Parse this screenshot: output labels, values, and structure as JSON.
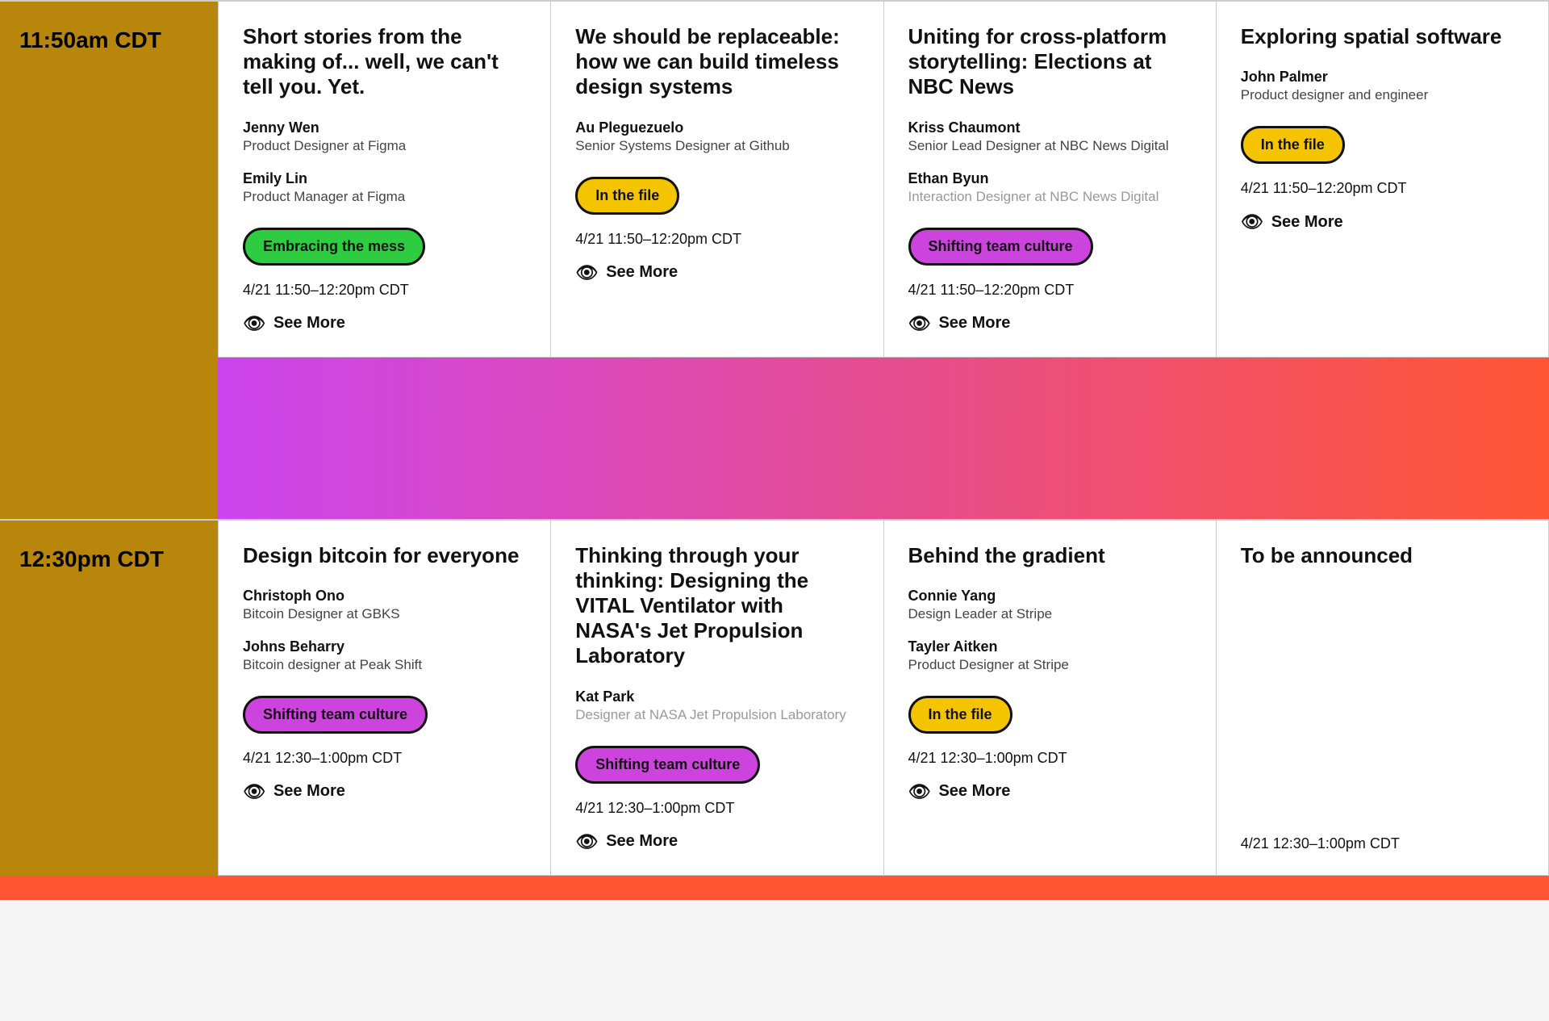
{
  "schedule": {
    "rows": [
      {
        "time": "11:50am CDT",
        "sessions": [
          {
            "title": "Short stories from the making of... well, we can't tell you. Yet.",
            "speakers": [
              {
                "name": "Jenny Wen",
                "role": "Product Designer at Figma",
                "faded": false
              },
              {
                "name": "Emily Lin",
                "role": "Product Manager at Figma",
                "faded": false
              }
            ],
            "tag": "Embracing the mess",
            "tag_color": "green",
            "time_slot": "4/21 11:50–12:20pm CDT",
            "see_more": "See More"
          },
          {
            "title": "We should be replaceable: how we can build timeless design systems",
            "speakers": [
              {
                "name": "Au Pleguezuelo",
                "role": "Senior Systems Designer at Github",
                "faded": false
              }
            ],
            "tag": "In the file",
            "tag_color": "yellow",
            "time_slot": "4/21 11:50–12:20pm CDT",
            "see_more": "See More"
          },
          {
            "title": "Uniting for cross-platform storytelling: Elections at NBC News",
            "speakers": [
              {
                "name": "Kriss Chaumont",
                "role": "Senior Lead Designer at NBC News Digital",
                "faded": false
              },
              {
                "name": "Ethan Byun",
                "role": "Interaction Designer at NBC News Digital",
                "faded": true
              }
            ],
            "tag": "Shifting team culture",
            "tag_color": "purple",
            "time_slot": "4/21 11:50–12:20pm CDT",
            "see_more": "See More"
          },
          {
            "title": "Exploring spatial software",
            "speakers": [
              {
                "name": "John Palmer",
                "role": "Product designer and engineer",
                "faded": false
              }
            ],
            "tag": "In the file",
            "tag_color": "yellow",
            "time_slot": "4/21 11:50–12:20pm CDT",
            "see_more": "See More"
          }
        ]
      },
      {
        "time": "12:30pm CDT",
        "sessions": [
          {
            "title": "Design bitcoin for everyone",
            "speakers": [
              {
                "name": "Christoph Ono",
                "role": "Bitcoin Designer at GBKS",
                "faded": false
              },
              {
                "name": "Johns Beharry",
                "role": "Bitcoin designer at Peak Shift",
                "faded": false
              }
            ],
            "tag": "Shifting team culture",
            "tag_color": "purple",
            "time_slot": "4/21 12:30–1:00pm CDT",
            "see_more": "See More"
          },
          {
            "title": "Thinking through your thinking: Designing the VITAL Ventilator with NASA's Jet Propulsion Laboratory",
            "speakers": [
              {
                "name": "Kat Park",
                "role": "Designer at NASA Jet Propulsion Laboratory",
                "faded": true
              }
            ],
            "tag": "Shifting team culture",
            "tag_color": "purple",
            "time_slot": "4/21 12:30–1:00pm CDT",
            "see_more": "See More"
          },
          {
            "title": "Behind the gradient",
            "speakers": [
              {
                "name": "Connie Yang",
                "role": "Design Leader at Stripe",
                "faded": false
              },
              {
                "name": "Tayler Aitken",
                "role": "Product Designer at Stripe",
                "faded": false
              }
            ],
            "tag": "In the file",
            "tag_color": "yellow",
            "time_slot": "4/21 12:30–1:00pm CDT",
            "see_more": "See More"
          },
          {
            "title": "To be announced",
            "speakers": [],
            "tag": null,
            "tag_color": null,
            "time_slot": "4/21 12:30–1:00pm CDT",
            "see_more": null
          }
        ]
      }
    ],
    "break": {
      "label": ""
    }
  },
  "labels": {
    "see_more": "See More"
  }
}
